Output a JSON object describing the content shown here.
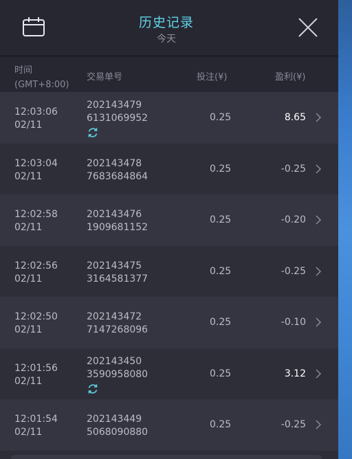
{
  "header": {
    "title": "历史记录",
    "subtitle": "今天"
  },
  "columns": {
    "time_line1": "时间",
    "time_line2": "(GMT+8:00)",
    "order": "交易单号",
    "bet": "投注(¥)",
    "profit": "盈利(¥)"
  },
  "rows": [
    {
      "time": "12:03:06",
      "date": "02/11",
      "order1": "202143479",
      "order2": "6131069952",
      "bet": "0.25",
      "profit": "8.65",
      "win": true
    },
    {
      "time": "12:03:04",
      "date": "02/11",
      "order1": "202143478",
      "order2": "7683684864",
      "bet": "0.25",
      "profit": "-0.25",
      "win": false
    },
    {
      "time": "12:02:58",
      "date": "02/11",
      "order1": "202143476",
      "order2": "1909681152",
      "bet": "0.25",
      "profit": "-0.20",
      "win": false
    },
    {
      "time": "12:02:56",
      "date": "02/11",
      "order1": "202143475",
      "order2": "3164581377",
      "bet": "0.25",
      "profit": "-0.25",
      "win": false
    },
    {
      "time": "12:02:50",
      "date": "02/11",
      "order1": "202143472",
      "order2": "7147268096",
      "bet": "0.25",
      "profit": "-0.10",
      "win": false
    },
    {
      "time": "12:01:56",
      "date": "02/11",
      "order1": "202143450",
      "order2": "3590958080",
      "bet": "0.25",
      "profit": "3.12",
      "win": true
    },
    {
      "time": "12:01:54",
      "date": "02/11",
      "order1": "202143449",
      "order2": "5068090880",
      "bet": "0.25",
      "profit": "-0.25",
      "win": false
    }
  ],
  "colors": {
    "accent": "#5fd3e6",
    "win_text": "#ffffff",
    "text": "#bdbdc7",
    "muted": "#8a8a98"
  },
  "icons": {
    "calendar": "calendar-icon",
    "close": "close-icon",
    "sync": "sync-icon",
    "chevron": "chevron-right-icon"
  }
}
